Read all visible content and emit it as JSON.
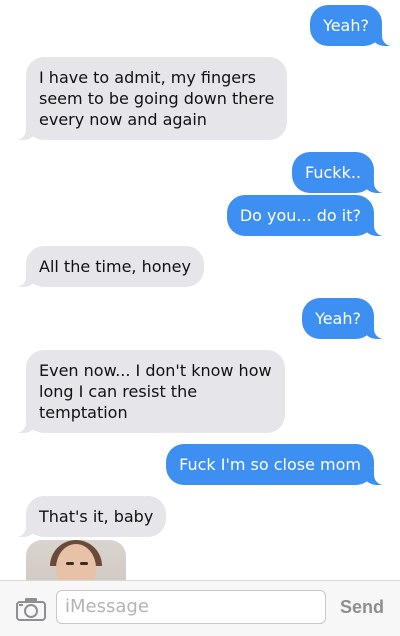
{
  "messages": [
    {
      "side": "sent",
      "text": "Yeah?"
    },
    {
      "side": "recv",
      "text": "I have to admit, my fingers\nseem to be going down there\nevery now and again"
    },
    {
      "side": "sent",
      "text": "Fuckk.."
    },
    {
      "side": "sent",
      "text": "Do you... do it?"
    },
    {
      "side": "recv",
      "text": "All the time, honey"
    },
    {
      "side": "sent",
      "text": "Yeah?"
    },
    {
      "side": "recv",
      "text": "Even now... I don't know how\nlong I can resist the\ntemptation"
    },
    {
      "side": "sent",
      "text": "Fuck I'm so close mom"
    },
    {
      "side": "recv",
      "text": "That's it, baby"
    }
  ],
  "photo_message": {
    "icon": "photo-thumbnail"
  },
  "input": {
    "camera_icon": "camera-icon",
    "placeholder": "iMessage",
    "send_label": "Send"
  },
  "colors": {
    "sent": "#3d8ff2",
    "received": "#e5e5ea"
  }
}
